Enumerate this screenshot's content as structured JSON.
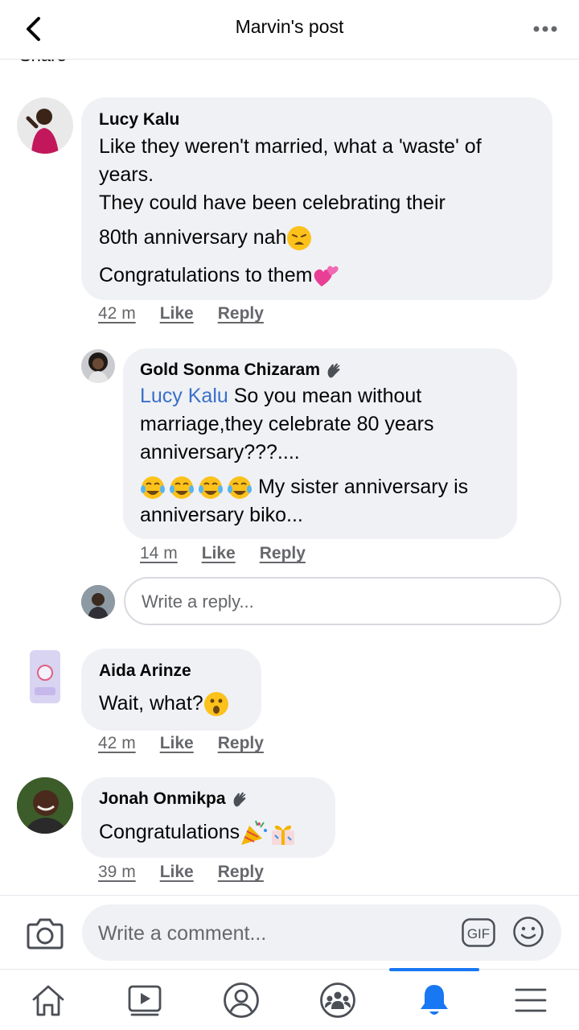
{
  "header": {
    "title": "Marvin's post",
    "back_icon": "chevron-left-icon",
    "more_icon": "more-horizontal-icon"
  },
  "cutoff_text": "Share",
  "comments": [
    {
      "author": "Lucy Kalu",
      "lines": [
        "Like they weren't married, what a 'waste' of",
        "years.",
        "They could have been celebrating their",
        "80th anniversary nah",
        "Congratulations to them"
      ],
      "time": "42 m",
      "like": "Like",
      "reply": "Reply"
    },
    {
      "author": "Gold Sonma Chizaram",
      "mention": "Lucy Kalu",
      "lines": [
        "So you mean without",
        "marriage,they  celebrate 80 years",
        "anniversary???....",
        "My sister anniversary is",
        "anniversary biko..."
      ],
      "time": "14 m",
      "like": "Like",
      "reply": "Reply"
    },
    {
      "author": "Aida Arinze",
      "lines": [
        "Wait, what?"
      ],
      "time": "42 m",
      "like": "Like",
      "reply": "Reply"
    },
    {
      "author": "Jonah Onmikpa",
      "lines": [
        "Congratulations"
      ],
      "time": "39 m",
      "like": "Like",
      "reply": "Reply"
    }
  ],
  "reply_input": {
    "placeholder": "Write a reply..."
  },
  "composer": {
    "placeholder": "Write a comment...",
    "gif_label": "GIF"
  },
  "nav": [
    "home-icon",
    "watch-icon",
    "profile-icon",
    "groups-icon",
    "notifications-icon",
    "menu-icon"
  ],
  "colors": {
    "accent": "#1877f2",
    "bubble": "#eff1f5",
    "mention": "#3a6fc9",
    "secondary_text": "#65676b"
  }
}
